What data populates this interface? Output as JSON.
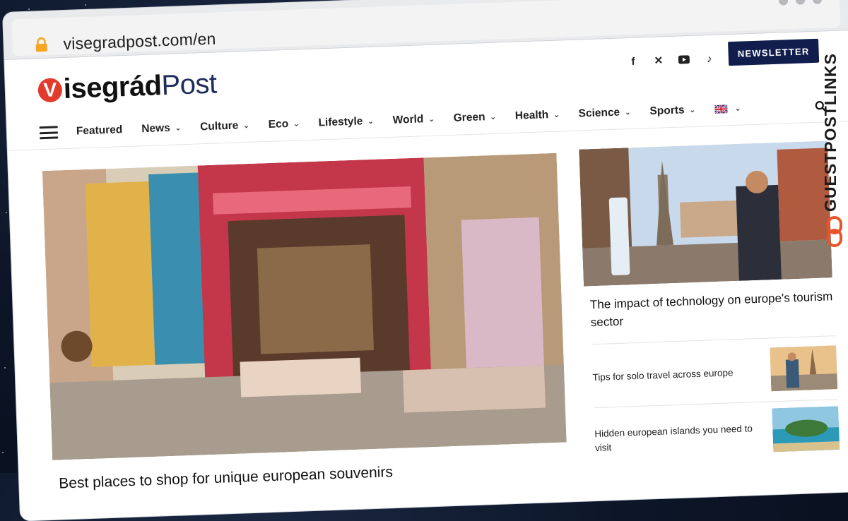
{
  "browser": {
    "url": "visegradpost.com/en"
  },
  "site": {
    "logo_initial": "V",
    "logo_bold": "isegrád",
    "logo_light": "Post",
    "newsletter_label": "NEWSLETTER",
    "social_icons": [
      "facebook-icon",
      "x-icon",
      "youtube-icon",
      "tiktok-icon"
    ],
    "accent_color": "#e23a2c",
    "nav_color": "#111d4d"
  },
  "nav": {
    "items": [
      {
        "label": "Featured",
        "dropdown": false
      },
      {
        "label": "News",
        "dropdown": true
      },
      {
        "label": "Culture",
        "dropdown": true
      },
      {
        "label": "Eco",
        "dropdown": true
      },
      {
        "label": "Lifestyle",
        "dropdown": true
      },
      {
        "label": "World",
        "dropdown": true
      },
      {
        "label": "Green",
        "dropdown": true
      },
      {
        "label": "Health",
        "dropdown": true
      },
      {
        "label": "Science",
        "dropdown": true
      },
      {
        "label": "Sports",
        "dropdown": true
      }
    ],
    "language_flag": "uk-flag-icon"
  },
  "main": {
    "hero_title": "Best places to shop for unique european souvenirs"
  },
  "side": {
    "featured_title": "The impact of technology on europe's tourism sector",
    "list": [
      {
        "title": "Tips for solo travel across europe"
      },
      {
        "title": "Hidden european islands you need to visit"
      }
    ]
  },
  "watermark": {
    "text": "GUESTPOSTLINKS"
  }
}
